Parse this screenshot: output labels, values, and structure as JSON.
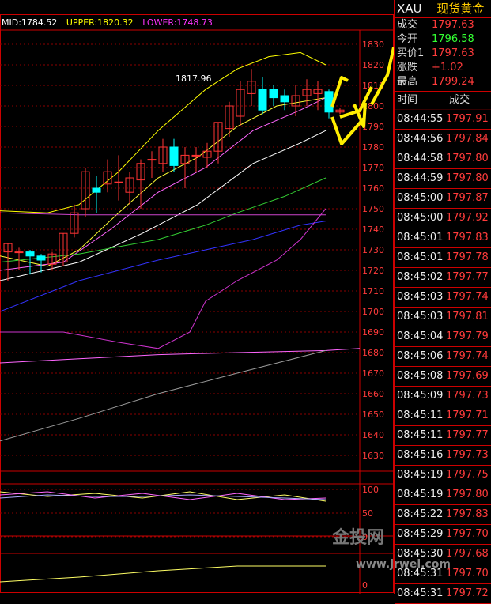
{
  "header": {
    "mid": "MID:1784.52",
    "upper": "UPPER:1820.32",
    "lower": "LOWER:1748.73"
  },
  "colors": {
    "mid": "#ffffff",
    "upper": "#ffff00",
    "lower": "#ff33ff",
    "bull": "#ff3333",
    "bear": "#00ffff",
    "grid": "#cc0000"
  },
  "main_axis": [
    "1830",
    "1820",
    "1810",
    "1800",
    "1790",
    "1780",
    "1770",
    "1760",
    "1750",
    "1740",
    "1730",
    "1720",
    "1710",
    "1700",
    "1690",
    "1680",
    "1670",
    "1660",
    "1650",
    "1640",
    "1630"
  ],
  "sub_axis": [
    "100",
    "50",
    "0"
  ],
  "sub2_axis": [
    "0"
  ],
  "annotation": "1817.96",
  "quote": {
    "symbol": "XAU",
    "name": "现货黄金",
    "rows": [
      {
        "label": "成交",
        "value": "1797.63",
        "color": "red"
      },
      {
        "label": "今开",
        "value": "1796.58",
        "color": "green"
      },
      {
        "label": "买价1",
        "value": "1797.63",
        "color": "red"
      },
      {
        "label": "涨跌",
        "value": "+1.02",
        "color": "red"
      },
      {
        "label": "最高",
        "value": "1799.24",
        "color": "red"
      }
    ]
  },
  "trades": {
    "col_time": "时间",
    "col_price": "成交",
    "rows": [
      {
        "time": "08:44:55",
        "price": "1797.91"
      },
      {
        "time": "08:44:56",
        "price": "1797.84"
      },
      {
        "time": "08:44:58",
        "price": "1797.80"
      },
      {
        "time": "08:44:59",
        "price": "1797.80"
      },
      {
        "time": "08:45:00",
        "price": "1797.87"
      },
      {
        "time": "08:45:00",
        "price": "1797.92"
      },
      {
        "time": "08:45:01",
        "price": "1797.83"
      },
      {
        "time": "08:45:01",
        "price": "1797.78"
      },
      {
        "time": "08:45:02",
        "price": "1797.77"
      },
      {
        "time": "08:45:03",
        "price": "1797.74"
      },
      {
        "time": "08:45:03",
        "price": "1797.81"
      },
      {
        "time": "08:45:04",
        "price": "1797.79"
      },
      {
        "time": "08:45:06",
        "price": "1797.74"
      },
      {
        "time": "08:45:08",
        "price": "1797.69"
      },
      {
        "time": "08:45:09",
        "price": "1797.73"
      },
      {
        "time": "08:45:11",
        "price": "1797.71"
      },
      {
        "time": "08:45:11",
        "price": "1797.77"
      },
      {
        "time": "08:45:16",
        "price": "1797.73"
      },
      {
        "time": "08:45:19",
        "price": "1797.75"
      },
      {
        "time": "08:45:19",
        "price": "1797.80"
      },
      {
        "time": "08:45:22",
        "price": "1797.83"
      },
      {
        "time": "08:45:29",
        "price": "1797.70"
      },
      {
        "time": "08:45:30",
        "price": "1797.68"
      },
      {
        "time": "08:45:31",
        "price": "1797.70"
      },
      {
        "time": "08:45:31",
        "price": "1797.72"
      }
    ]
  },
  "watermark": {
    "brand": "金投网",
    "url": "www.jrwei.com"
  },
  "candles": [
    {
      "o": 1729,
      "h": 1733,
      "l": 1715,
      "c": 1733
    },
    {
      "o": 1729,
      "h": 1731,
      "l": 1720,
      "c": 1729
    },
    {
      "o": 1729,
      "h": 1730,
      "l": 1718,
      "c": 1727
    },
    {
      "o": 1727,
      "h": 1728,
      "l": 1719,
      "c": 1725
    },
    {
      "o": 1723,
      "h": 1729,
      "l": 1720,
      "c": 1728
    },
    {
      "o": 1724,
      "h": 1738,
      "l": 1722,
      "c": 1738
    },
    {
      "o": 1738,
      "h": 1752,
      "l": 1736,
      "c": 1748
    },
    {
      "o": 1750,
      "h": 1770,
      "l": 1746,
      "c": 1768
    },
    {
      "o": 1760,
      "h": 1766,
      "l": 1748,
      "c": 1758
    },
    {
      "o": 1762,
      "h": 1774,
      "l": 1758,
      "c": 1768
    },
    {
      "o": 1763,
      "h": 1776,
      "l": 1754,
      "c": 1763
    },
    {
      "o": 1758,
      "h": 1768,
      "l": 1752,
      "c": 1765
    },
    {
      "o": 1764,
      "h": 1774,
      "l": 1750,
      "c": 1772
    },
    {
      "o": 1774,
      "h": 1778,
      "l": 1765,
      "c": 1774
    },
    {
      "o": 1772,
      "h": 1784,
      "l": 1768,
      "c": 1780
    },
    {
      "o": 1780,
      "h": 1784,
      "l": 1768,
      "c": 1771
    },
    {
      "o": 1772,
      "h": 1780,
      "l": 1760,
      "c": 1776
    },
    {
      "o": 1776,
      "h": 1780,
      "l": 1768,
      "c": 1776
    },
    {
      "o": 1775,
      "h": 1782,
      "l": 1770,
      "c": 1778
    },
    {
      "o": 1778,
      "h": 1792,
      "l": 1772,
      "c": 1792
    },
    {
      "o": 1789,
      "h": 1802,
      "l": 1785,
      "c": 1800
    },
    {
      "o": 1795,
      "h": 1812,
      "l": 1790,
      "c": 1808
    },
    {
      "o": 1806,
      "h": 1818,
      "l": 1800,
      "c": 1812
    },
    {
      "o": 1808,
      "h": 1814,
      "l": 1796,
      "c": 1798
    },
    {
      "o": 1808,
      "h": 1810,
      "l": 1800,
      "c": 1804
    },
    {
      "o": 1805,
      "h": 1808,
      "l": 1798,
      "c": 1802
    },
    {
      "o": 1800,
      "h": 1810,
      "l": 1795,
      "c": 1805
    },
    {
      "o": 1805,
      "h": 1813,
      "l": 1800,
      "c": 1808
    },
    {
      "o": 1806,
      "h": 1812,
      "l": 1798,
      "c": 1808
    },
    {
      "o": 1807,
      "h": 1808,
      "l": 1794,
      "c": 1797
    },
    {
      "o": 1797,
      "h": 1799,
      "l": 1796,
      "c": 1798
    }
  ]
}
